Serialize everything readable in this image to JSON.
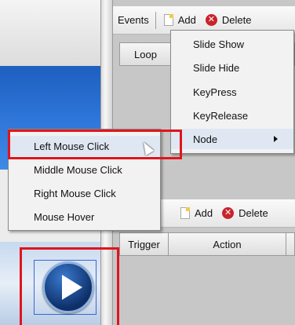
{
  "toolbar_top": {
    "events_label": "Events",
    "add_label": "Add",
    "delete_label": "Delete"
  },
  "grid_top": {
    "columns": [
      "Loop",
      ""
    ]
  },
  "events_menu": {
    "items": [
      "Slide Show",
      "Slide Hide",
      "KeyPress",
      "KeyRelease",
      "Node"
    ]
  },
  "node_submenu": {
    "items": [
      "Left Mouse Click",
      "Middle Mouse Click",
      "Right Mouse Click",
      "Mouse Hover"
    ],
    "highlighted": "Left Mouse Click"
  },
  "toolbar_mid": {
    "add_label": "Add",
    "delete_label": "Delete"
  },
  "grid_bottom": {
    "columns": [
      "Trigger",
      "Action"
    ]
  },
  "icons": {
    "add": "new-document-icon",
    "delete": "delete-x-icon",
    "submenu": "submenu-arrow-icon",
    "slide": "play-icon"
  },
  "colors": {
    "highlight": "#e0151d",
    "delete": "#c8232c",
    "selection": "#3b66d6"
  }
}
